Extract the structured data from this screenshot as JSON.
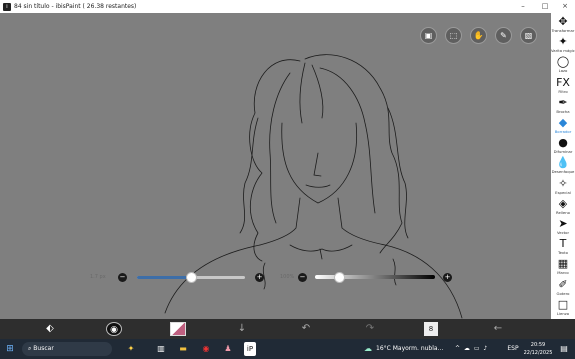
{
  "window": {
    "title": "84 sin título - ibisPaint ( 26.38 restantes)",
    "controls": [
      "–",
      "□",
      "×"
    ]
  },
  "top_buttons": [
    {
      "name": "layer-toggle",
      "glyph": "▣"
    },
    {
      "name": "selection-toggle",
      "glyph": "⬚"
    },
    {
      "name": "hand-toggle",
      "glyph": "✋"
    },
    {
      "name": "ruler-toggle",
      "glyph": "✎"
    },
    {
      "name": "image-toggle",
      "glyph": "▧"
    }
  ],
  "tools": [
    {
      "id": "transform",
      "icon": "✥",
      "label": "Transformar"
    },
    {
      "id": "magic-wand",
      "icon": "✦",
      "label": "Varita mágica"
    },
    {
      "id": "lasso",
      "icon": "◯",
      "label": "Lazo"
    },
    {
      "id": "filter",
      "icon": "FX",
      "label": "Filtro"
    },
    {
      "id": "brush",
      "icon": "✒",
      "label": "Brocha"
    },
    {
      "id": "eraser",
      "icon": "◆",
      "label": "Borrador",
      "active": true
    },
    {
      "id": "smudge",
      "icon": "●",
      "label": "Difuminar"
    },
    {
      "id": "blur",
      "icon": "💧",
      "label": "Desenfoque"
    },
    {
      "id": "special",
      "icon": "✧",
      "label": "Especial"
    },
    {
      "id": "fill",
      "icon": "◈",
      "label": "Relleno"
    },
    {
      "id": "vector",
      "icon": "➤",
      "label": "Vector"
    },
    {
      "id": "text",
      "icon": "T",
      "label": "Texto"
    },
    {
      "id": "frame",
      "icon": "▦",
      "label": "Marco"
    },
    {
      "id": "eyedropper",
      "icon": "✐",
      "label": "Gotero"
    },
    {
      "id": "canvas",
      "icon": "□",
      "label": "Lienzo"
    }
  ],
  "sliders": {
    "size": {
      "label": "1.7 px",
      "value": 0.5
    },
    "opacity": {
      "label": "100%",
      "value": 0.2
    }
  },
  "bottom_toolbar": [
    {
      "name": "tool-swap",
      "glyph": "⬖"
    },
    {
      "name": "brush-preview",
      "glyph": "◉"
    },
    {
      "name": "color-swatch",
      "glyph": "◩"
    },
    {
      "name": "arrow-down",
      "glyph": "↓"
    },
    {
      "name": "undo",
      "glyph": "↶"
    },
    {
      "name": "redo",
      "glyph": "↷"
    },
    {
      "name": "layer-count",
      "glyph": "8"
    },
    {
      "name": "back",
      "glyph": "←"
    }
  ],
  "taskbar": {
    "search_placeholder": "Buscar",
    "weather": "16°C  Mayorm. nubla...",
    "time": "20:59",
    "date": "22/12/2025",
    "lang": "ESP"
  }
}
